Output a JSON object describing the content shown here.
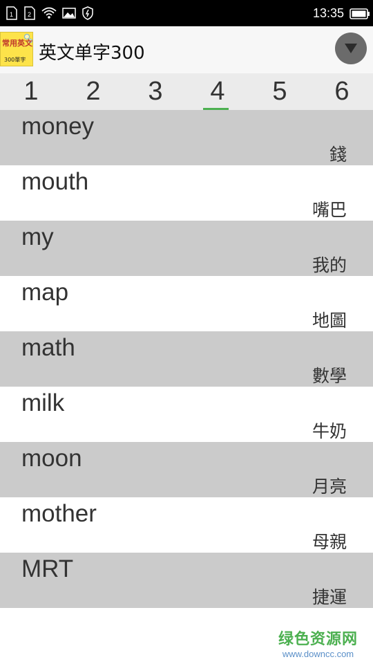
{
  "status_bar": {
    "sim1": "1",
    "sim2": "2",
    "icons": [
      "sim-1-icon",
      "sim-2-icon",
      "wifi-icon",
      "image-icon",
      "shield-icon",
      "battery-icon"
    ],
    "time": "13:35"
  },
  "app_bar": {
    "logo_text_top": "常用英文",
    "logo_text_bottom": "300單字",
    "title": "英文单字300",
    "dropdown_icon": "triangle-down-icon"
  },
  "tabs": {
    "items": [
      {
        "label": "1"
      },
      {
        "label": "2"
      },
      {
        "label": "3"
      },
      {
        "label": "4"
      },
      {
        "label": "5"
      },
      {
        "label": "6"
      }
    ],
    "selected": "4",
    "indicator_color": "#4cb050"
  },
  "words": [
    {
      "english": "money",
      "chinese": "錢"
    },
    {
      "english": "mouth",
      "chinese": "嘴巴"
    },
    {
      "english": "my",
      "chinese": "我的"
    },
    {
      "english": "map",
      "chinese": "地圖"
    },
    {
      "english": "math",
      "chinese": "數學"
    },
    {
      "english": "milk",
      "chinese": "牛奶"
    },
    {
      "english": "moon",
      "chinese": "月亮"
    },
    {
      "english": "mother",
      "chinese": "母親"
    },
    {
      "english": "MRT",
      "chinese": "捷運"
    }
  ],
  "colors": {
    "row_alt": "#cbcbcb",
    "row_plain": "#ffffff",
    "accent": "#4cb050"
  },
  "watermark": {
    "name": "绿色资源网",
    "url": "www.downcc.com"
  }
}
